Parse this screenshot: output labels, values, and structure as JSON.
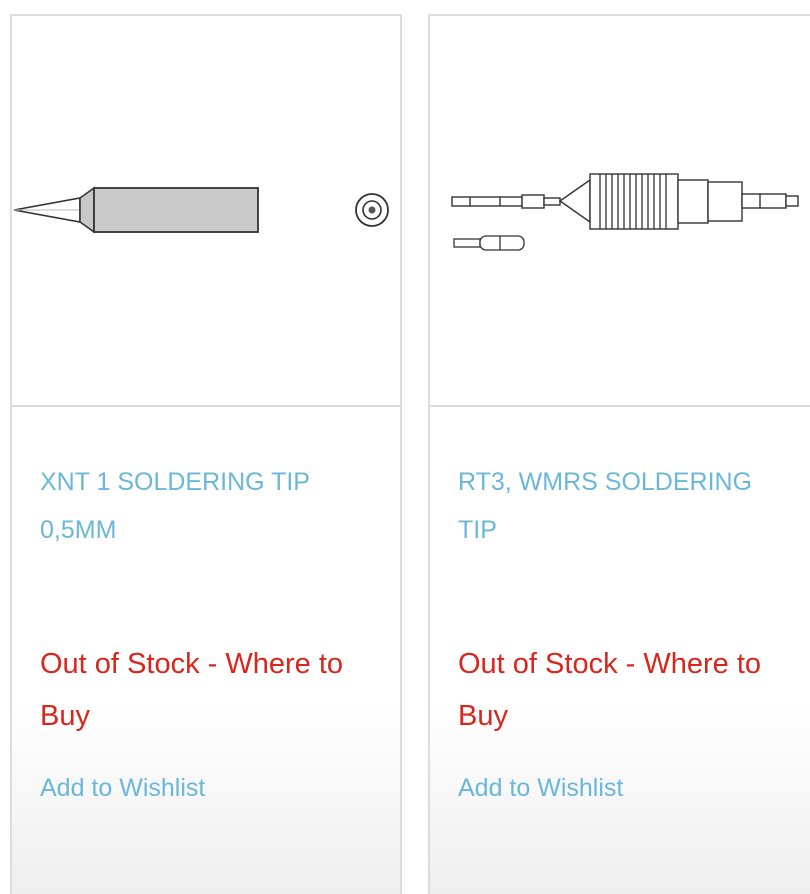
{
  "products": [
    {
      "title": "XNT 1 SOLDERING TIP 0,5MM",
      "stock_status": "Out of Stock - Where to Buy",
      "wishlist_label": "Add to Wishlist",
      "image_icon": "soldering-tip-icon"
    },
    {
      "title": "RT3, WMRS SOLDERING TIP",
      "stock_status": "Out of Stock - Where to Buy",
      "wishlist_label": "Add to Wishlist",
      "image_icon": "soldering-cartridge-icon"
    }
  ],
  "colors": {
    "link": "#6ab7d8",
    "stock": "#d9261c",
    "border": "#dcdcdc"
  }
}
